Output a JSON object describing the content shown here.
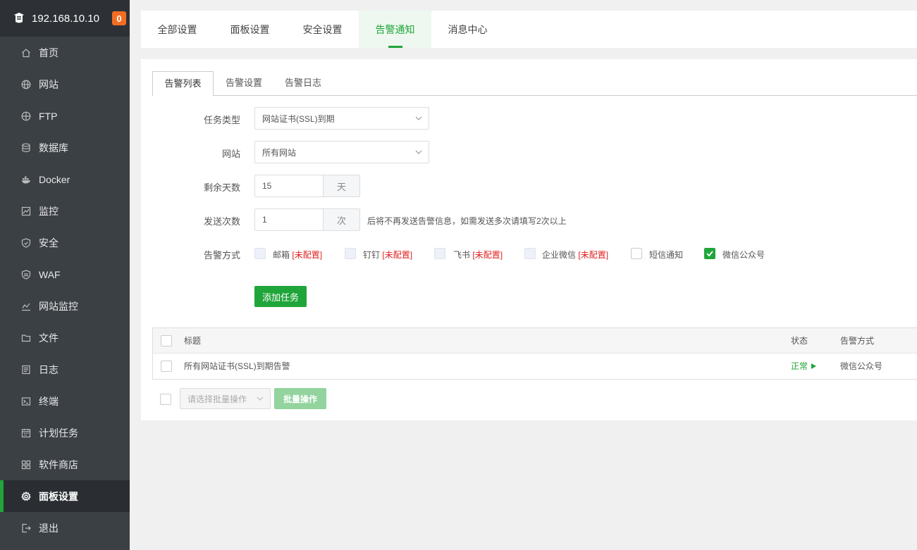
{
  "sidebar": {
    "server_ip": "192.168.10.10",
    "badge": "0",
    "items": [
      {
        "label": "首页",
        "icon": "home-icon"
      },
      {
        "label": "网站",
        "icon": "globe-icon"
      },
      {
        "label": "FTP",
        "icon": "ftp-icon"
      },
      {
        "label": "数据库",
        "icon": "database-icon"
      },
      {
        "label": "Docker",
        "icon": "docker-icon"
      },
      {
        "label": "监控",
        "icon": "monitor-icon"
      },
      {
        "label": "安全",
        "icon": "shield-icon"
      },
      {
        "label": "WAF",
        "icon": "waf-icon"
      },
      {
        "label": "网站监控",
        "icon": "chart-line-icon"
      },
      {
        "label": "文件",
        "icon": "folder-icon"
      },
      {
        "label": "日志",
        "icon": "log-icon"
      },
      {
        "label": "终端",
        "icon": "terminal-icon"
      },
      {
        "label": "计划任务",
        "icon": "calendar-icon"
      },
      {
        "label": "软件商店",
        "icon": "grid-icon"
      },
      {
        "label": "面板设置",
        "icon": "gear-icon",
        "active": true
      },
      {
        "label": "退出",
        "icon": "logout-icon"
      }
    ]
  },
  "top_tabs": [
    {
      "label": "全部设置"
    },
    {
      "label": "面板设置"
    },
    {
      "label": "安全设置"
    },
    {
      "label": "告警通知",
      "active": true
    },
    {
      "label": "消息中心"
    }
  ],
  "sub_tabs": [
    {
      "label": "告警列表",
      "active": true
    },
    {
      "label": "告警设置"
    },
    {
      "label": "告警日志"
    }
  ],
  "form": {
    "task_type": {
      "label": "任务类型",
      "value": "网站证书(SSL)到期"
    },
    "site": {
      "label": "网站",
      "value": "所有网站"
    },
    "remaining_days": {
      "label": "剩余天数",
      "value": "15",
      "unit": "天"
    },
    "send_count": {
      "label": "发送次数",
      "value": "1",
      "unit": "次",
      "hint": "后将不再发送告警信息，如需发送多次请填写2次以上"
    },
    "alert_methods": {
      "label": "告警方式",
      "options": [
        {
          "name": "邮箱",
          "note": "[未配置]",
          "checked": false,
          "disabled": true
        },
        {
          "name": "钉钉",
          "note": "[未配置]",
          "checked": false,
          "disabled": true
        },
        {
          "name": "飞书",
          "note": "[未配置]",
          "checked": false,
          "disabled": true
        },
        {
          "name": "企业微信",
          "note": "[未配置]",
          "checked": false,
          "disabled": true
        },
        {
          "name": "短信通知",
          "note": "",
          "checked": false,
          "disabled": false
        },
        {
          "name": "微信公众号",
          "note": "",
          "checked": true,
          "disabled": false
        }
      ]
    },
    "add_button": "添加任务"
  },
  "table": {
    "headers": {
      "title": "标题",
      "status": "状态",
      "method": "告警方式"
    },
    "rows": [
      {
        "title": "所有网站证书(SSL)到期告警",
        "status": "正常",
        "method": "微信公众号"
      }
    ]
  },
  "batch": {
    "placeholder": "请选择批量操作",
    "button": "批量操作"
  },
  "colors": {
    "accent": "#20a53a",
    "sidebar_bg": "#3b4045",
    "badge": "#f26d21",
    "warning_text": "#e02020"
  }
}
